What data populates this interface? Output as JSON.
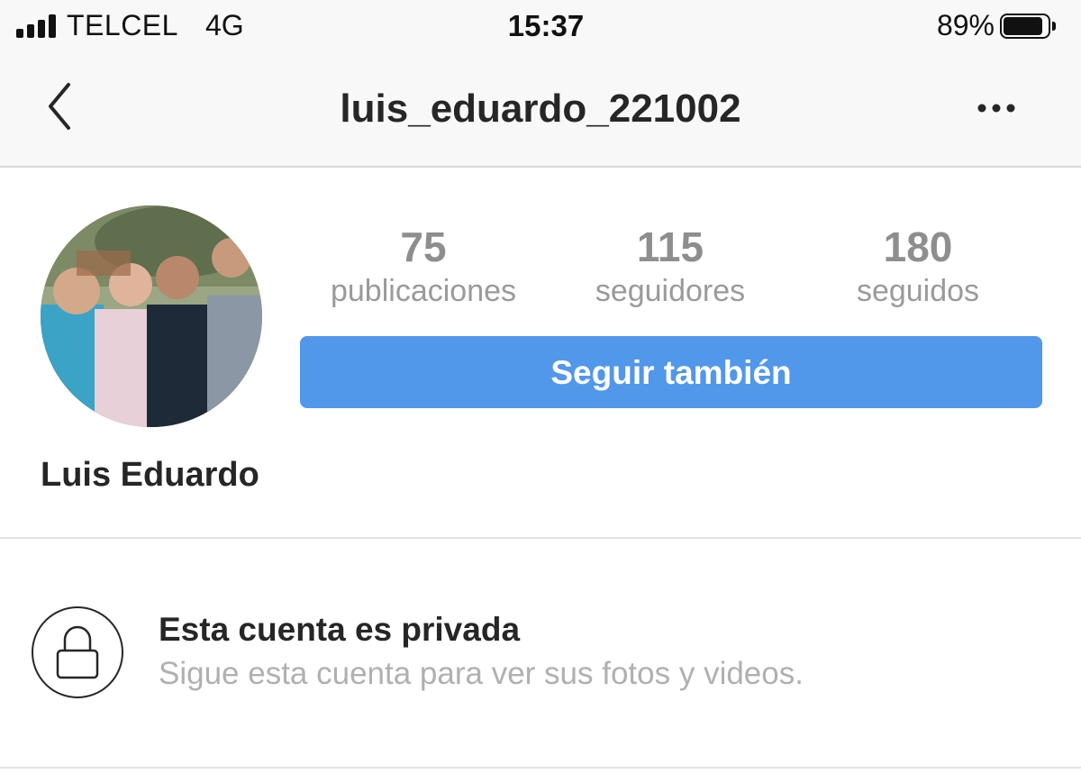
{
  "status_bar": {
    "carrier": "TELCEL",
    "network": "4G",
    "time": "15:37",
    "battery_percent": "89%",
    "battery_level": 0.89,
    "signal_bars": 4
  },
  "nav": {
    "title": "luis_eduardo_221002",
    "back_icon": "chevron-left-icon",
    "more_icon": "more-horizontal-icon"
  },
  "profile": {
    "display_name": "Luis Eduardo",
    "avatar_description_icon": "profile-photo",
    "stats": [
      {
        "value": "75",
        "label": "publicaciones"
      },
      {
        "value": "115",
        "label": "seguidores"
      },
      {
        "value": "180",
        "label": "seguidos"
      }
    ],
    "follow_button_label": "Seguir también"
  },
  "private_notice": {
    "icon": "lock-icon",
    "title": "Esta cuenta es privada",
    "subtitle": "Sigue esta cuenta para ver sus fotos y videos."
  },
  "colors": {
    "follow_button": "#5197ea",
    "stat_text": "#8e8e8e",
    "subtitle_text": "#b0b0b0",
    "bar_background": "#f8f8f8"
  }
}
